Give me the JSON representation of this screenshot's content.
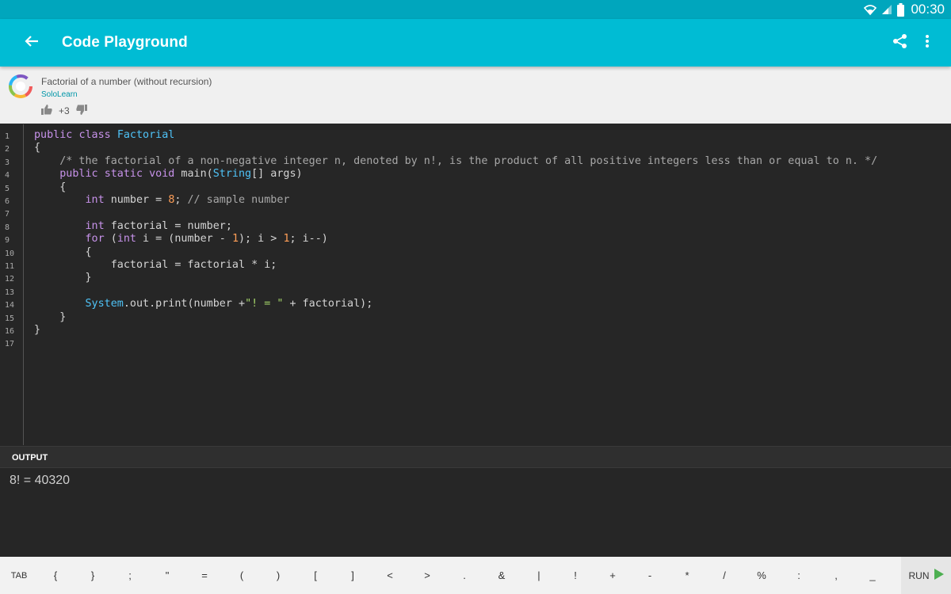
{
  "status_bar": {
    "time": "00:30"
  },
  "app_bar": {
    "title": "Code Playground"
  },
  "info": {
    "code_title": "Factorial of a number (without recursion)",
    "author": "SoloLearn",
    "votes": "+3"
  },
  "editor": {
    "line_numbers": [
      "1",
      "2",
      "3",
      "4",
      "5",
      "6",
      "7",
      "8",
      "9",
      "10",
      "11",
      "12",
      "13",
      "14",
      "15",
      "16",
      "17"
    ],
    "lines": [
      "public class Factorial",
      "{",
      "    /* the factorial of a non-negative integer n, denoted by n!, is the product of all positive integers less than or equal to n. */",
      "    public static void main(String[] args)",
      "    {",
      "        int number = 8; // sample number",
      "",
      "        int factorial = number;",
      "        for (int i = (number - 1); i > 1; i--)",
      "        {",
      "            factorial = factorial * i;",
      "        }",
      "",
      "        System.out.print(number +\"! = \" + factorial);",
      "    }",
      "}",
      ""
    ]
  },
  "output": {
    "label": "OUTPUT",
    "text": "8! = 40320"
  },
  "keybar": {
    "keys": [
      "TAB",
      "{",
      "}",
      ";",
      "\"",
      "=",
      "(",
      ")",
      "[",
      "]",
      "<",
      ">",
      ".",
      "&",
      "|",
      "!",
      "+",
      "-",
      "*",
      "/",
      "%",
      ":",
      ",",
      "_"
    ],
    "run_label": "RUN"
  },
  "colors": {
    "status_bar": "#00a6bd",
    "app_bar": "#00bcd4",
    "editor_bg": "#262626",
    "keyword": "#c792ea",
    "class_name": "#4fc3f7",
    "number": "#ff9e57",
    "comment": "#a8a8a8",
    "string": "#a5d66a",
    "run_play": "#4caf50"
  },
  "icons": [
    "wifi-icon",
    "signal-icon",
    "battery-icon",
    "back-arrow-icon",
    "share-icon",
    "more-vert-icon",
    "sololearn-logo",
    "thumb-up-icon",
    "thumb-down-icon",
    "play-icon"
  ]
}
